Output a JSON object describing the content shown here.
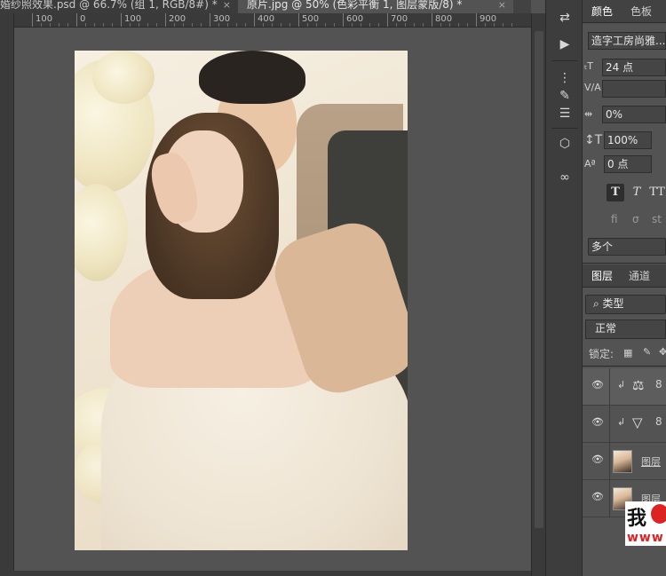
{
  "tabs": [
    {
      "label": "婚纱照效果.psd @ 66.7% (组 1, RGB/8#) *",
      "close": "×"
    },
    {
      "label": "原片.jpg @ 50% (色彩平衡 1, 图层蒙版/8) *",
      "close": "×"
    }
  ],
  "ruler": {
    "ticks": [
      "100",
      "0",
      "100",
      "200",
      "300",
      "400",
      "500",
      "600",
      "700",
      "800",
      "900"
    ]
  },
  "tools": [
    "swap-arrows-icon",
    "play-icon",
    "brush-presets-icon",
    "brush-icon",
    "adjust-sliders-icon",
    "3d-cube-icon",
    "creative-cloud-icon"
  ],
  "panel": {
    "tabs": {
      "color": "颜色",
      "swatches": "色板"
    },
    "font_family": "造字工房尚雅...",
    "font_size": "24 点",
    "kerning": "",
    "tracking": "0%",
    "vertical_scale": "100%",
    "baseline_shift": "0 点",
    "style_buttons": [
      "T",
      "T",
      "TT"
    ],
    "ligature_glyphs": [
      "fi",
      "σ",
      "st"
    ],
    "language": "多个",
    "layer_tabs": {
      "layers": "图层",
      "channels": "通道"
    },
    "filter": "类型",
    "blend_mode": "正常",
    "lock_label": "锁定:"
  },
  "layers": [
    {
      "type": "adjustment",
      "icon": "balance-scale-icon",
      "selected": true
    },
    {
      "type": "adjustment",
      "icon": "triangle-icon",
      "selected": false
    },
    {
      "type": "image",
      "name": "图层",
      "selected": false
    },
    {
      "type": "image",
      "name": "图层",
      "selected": false
    }
  ],
  "watermark": {
    "char": "我",
    "url": "www"
  }
}
